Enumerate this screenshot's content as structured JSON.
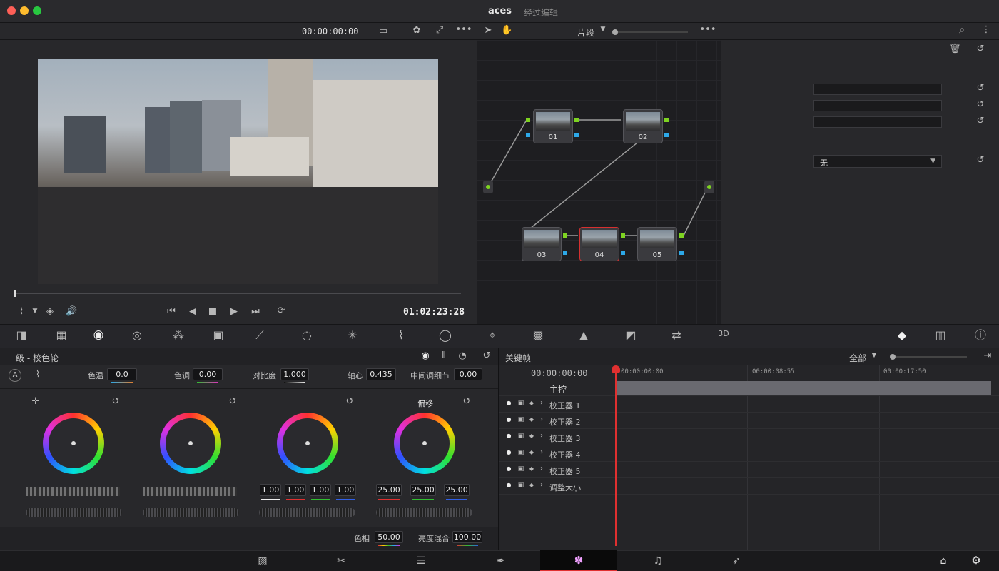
{
  "window": {
    "title": "aces",
    "subtitle": "经过编辑"
  },
  "viewer": {
    "timecode_top": "00:00:00:00",
    "timecode_bottom": "01:02:23:28",
    "clip_mode_label": "片段"
  },
  "nodes": [
    {
      "id": "01",
      "label": "01"
    },
    {
      "id": "02",
      "label": "02"
    },
    {
      "id": "03",
      "label": "03"
    },
    {
      "id": "04",
      "label": "04"
    },
    {
      "id": "05",
      "label": "05"
    }
  ],
  "inspector": {
    "dropdown_value": "无"
  },
  "color_wheels": {
    "panel_title": "一级 - 校色轮",
    "temp_label": "色温",
    "temp_value": "0.0",
    "tint_label": "色调",
    "tint_value": "0.00",
    "contrast_label": "对比度",
    "contrast_value": "1.000",
    "pivot_label": "轴心",
    "pivot_value": "0.435",
    "middetail_label": "中间调细节",
    "middetail_value": "0.00",
    "offset_label": "偏移",
    "gain_values": [
      "1.00",
      "1.00",
      "1.00",
      "1.00"
    ],
    "offset_values": [
      "25.00",
      "25.00",
      "25.00"
    ],
    "hue_label": "色相",
    "hue_value": "50.00",
    "lummix_label": "亮度混合",
    "lummix_value": "100.00"
  },
  "keyframes": {
    "title": "关键帧",
    "filter_label": "全部",
    "timecode": "00:00:00:00",
    "ruler": [
      "00:00:00:00",
      "00:00:08:55",
      "00:00:17:50"
    ],
    "master_label": "主控",
    "tracks": [
      "校正器 1",
      "校正器 2",
      "校正器 3",
      "校正器 4",
      "校正器 5",
      "调整大小"
    ]
  },
  "colors": {
    "accent": "#e03030",
    "node_green": "#7ed321",
    "node_blue": "#2da8e8"
  }
}
